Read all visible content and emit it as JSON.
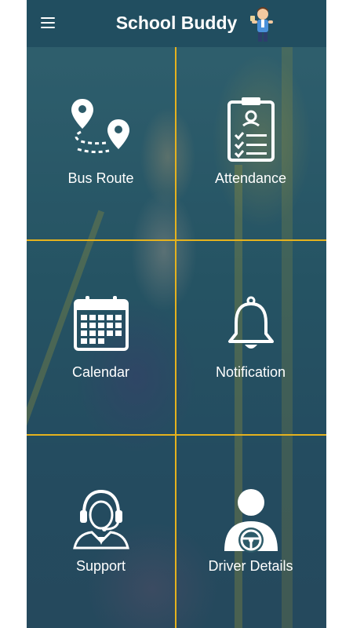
{
  "app": {
    "title": "School Buddy"
  },
  "tiles": [
    {
      "label": "Bus Route",
      "icon": "bus-route-icon"
    },
    {
      "label": "Attendance",
      "icon": "attendance-clipboard-icon"
    },
    {
      "label": "Calendar",
      "icon": "calendar-icon"
    },
    {
      "label": "Notification",
      "icon": "bell-icon"
    },
    {
      "label": "Support",
      "icon": "headset-support-icon"
    },
    {
      "label": "Driver Details",
      "icon": "driver-steering-wheel-icon"
    }
  ],
  "colors": {
    "appbar": "#214e60",
    "grid_lines": "#e5b21e",
    "text": "#ffffff"
  }
}
